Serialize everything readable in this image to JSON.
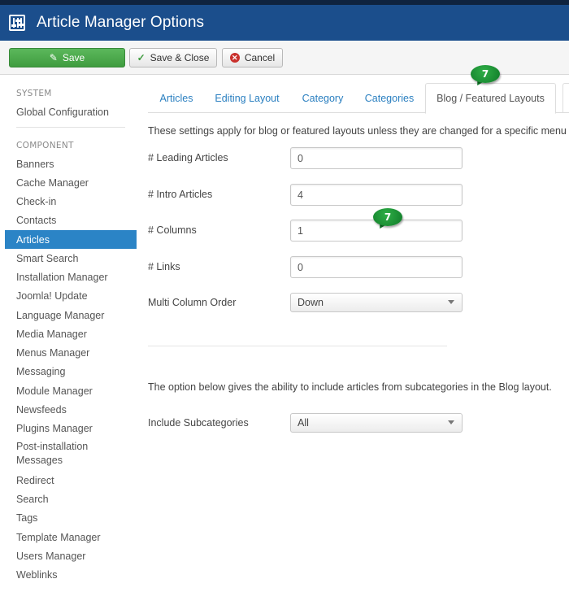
{
  "header": {
    "title": "Article Manager Options",
    "icon": "options-icon"
  },
  "toolbar": {
    "save_label": "Save",
    "save_close_label": "Save & Close",
    "cancel_label": "Cancel"
  },
  "sidebar": {
    "system_heading": "SYSTEM",
    "global_config": "Global Configuration",
    "component_heading": "COMPONENT",
    "items": [
      {
        "label": "Banners"
      },
      {
        "label": "Cache Manager"
      },
      {
        "label": "Check-in"
      },
      {
        "label": "Contacts"
      },
      {
        "label": "Articles",
        "active": true
      },
      {
        "label": "Smart Search"
      },
      {
        "label": "Installation Manager"
      },
      {
        "label": "Joomla! Update"
      },
      {
        "label": "Language Manager"
      },
      {
        "label": "Media Manager"
      },
      {
        "label": "Menus Manager"
      },
      {
        "label": "Messaging"
      },
      {
        "label": "Module Manager"
      },
      {
        "label": "Newsfeeds"
      },
      {
        "label": "Plugins Manager"
      },
      {
        "label": "Post-installation Messages"
      },
      {
        "label": "Redirect"
      },
      {
        "label": "Search"
      },
      {
        "label": "Tags"
      },
      {
        "label": "Template Manager"
      },
      {
        "label": "Users Manager"
      },
      {
        "label": "Weblinks"
      }
    ]
  },
  "tabs": [
    {
      "label": "Articles"
    },
    {
      "label": "Editing Layout"
    },
    {
      "label": "Category"
    },
    {
      "label": "Categories"
    },
    {
      "label": "Blog / Featured Layouts",
      "active": true
    }
  ],
  "main": {
    "intro": "These settings apply for blog or featured layouts unless they are changed for a specific menu",
    "fields": [
      {
        "label": "# Leading Articles",
        "value": "0"
      },
      {
        "label": "# Intro Articles",
        "value": "4"
      },
      {
        "label": "# Columns",
        "value": "1"
      },
      {
        "label": "# Links",
        "value": "0"
      }
    ],
    "multi_column_order": {
      "label": "Multi Column Order",
      "value": "Down"
    },
    "note": "The option below gives the ability to include articles from subcategories in the Blog layout.",
    "include_subcategories": {
      "label": "Include Subcategories",
      "value": "All"
    }
  },
  "markers": [
    {
      "number": "7"
    },
    {
      "number": "7"
    }
  ],
  "colors": {
    "header": "#1b4e8c",
    "active": "#2b84c6",
    "save": "#5cb85c",
    "marker": "#1a9a3a"
  }
}
